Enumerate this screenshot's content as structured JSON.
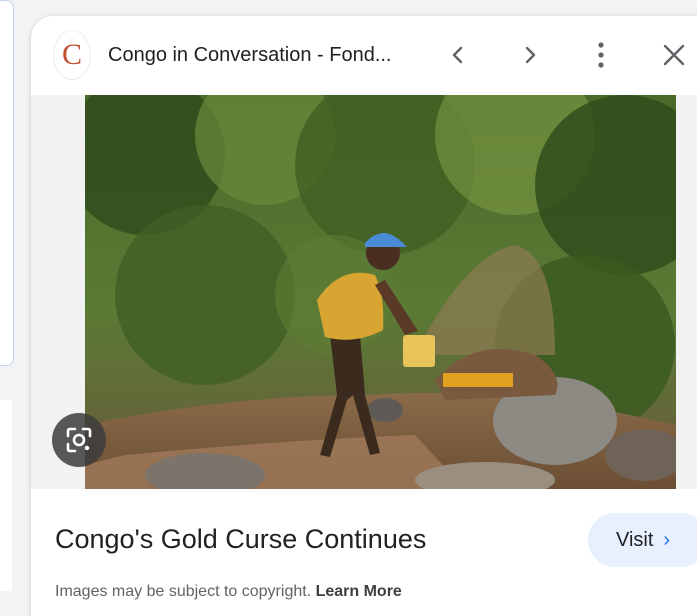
{
  "header": {
    "favicon_letter": "C",
    "title": "Congo in Conversation - Fond..."
  },
  "image": {
    "alt_subject": "person carrying a yellow container at a muddy mining site"
  },
  "caption": {
    "title": "Congo's Gold Curse Continues",
    "visit_label": "Visit",
    "visit_chevron": "›"
  },
  "footer": {
    "copyright_text": "Images may be subject to copyright.",
    "learn_more": "Learn More"
  },
  "colors": {
    "accent": "#1a73e8",
    "visit_bg": "#e8f0fe",
    "favicon": "#c0502d"
  }
}
